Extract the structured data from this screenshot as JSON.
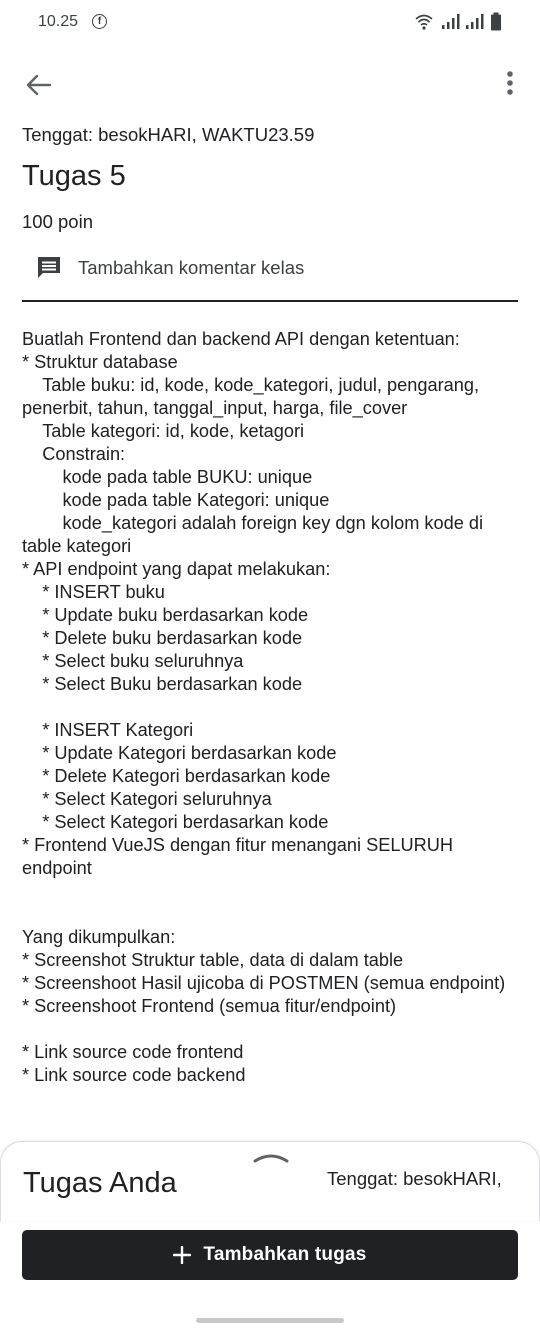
{
  "status_bar": {
    "time": "10.25",
    "notification_badge": "f",
    "icons": [
      "wifi-icon",
      "signal-icon",
      "signal-icon",
      "battery-icon"
    ]
  },
  "app_bar": {
    "back_icon": "arrow-back-icon",
    "more_icon": "more-vert-icon"
  },
  "assignment": {
    "due": "Tenggat: besokHARI, WAKTU23.59",
    "title": "Tugas 5",
    "points": "100 poin",
    "comment_label": "Tambahkan komentar kelas",
    "description": "Buatlah Frontend dan backend API dengan ketentuan:\n* Struktur database\n    Table buku: id, kode, kode_kategori, judul, pengarang, penerbit, tahun, tanggal_input, harga, file_cover\n    Table kategori: id, kode, ketagori\n    Constrain:\n        kode pada table BUKU: unique\n        kode pada table Kategori: unique\n        kode_kategori adalah foreign key dgn kolom kode di table kategori\n* API endpoint yang dapat melakukan:\n    * INSERT buku\n    * Update buku berdasarkan kode\n    * Delete buku berdasarkan kode\n    * Select buku seluruhnya\n    * Select Buku berdasarkan kode\n\n    * INSERT Kategori\n    * Update Kategori berdasarkan kode\n    * Delete Kategori berdasarkan kode\n    * Select Kategori seluruhnya\n    * Select Kategori berdasarkan kode\n* Frontend VueJS dengan fitur menangani SELURUH endpoint\n\n\nYang dikumpulkan:\n* Screenshot Struktur table, data di dalam table\n* Screenshoot Hasil ujicoba di POSTMEN (semua endpoint)\n* Screenshoot Frontend (semua fitur/endpoint)\n\n* Link source code frontend\n* Link source code backend"
  },
  "your_work": {
    "title": "Tugas Anda",
    "due": "Tenggat: besokHARI,",
    "add_button": "Tambahkan tugas"
  },
  "colors": {
    "text": "#202124",
    "button_bg": "#202124",
    "button_text": "#ffffff",
    "divider": "#202124"
  }
}
